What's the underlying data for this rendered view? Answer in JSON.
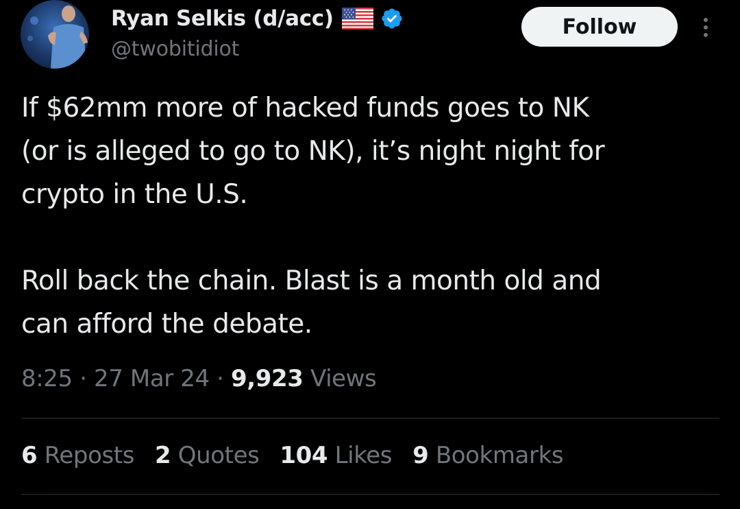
{
  "author": {
    "display_name": "Ryan Selkis (d/acc)",
    "handle": "@twobitidiot",
    "flag_icon": "us-flag-icon",
    "verified_icon": "verified-badge-icon",
    "verified_color": "#1d9bf0"
  },
  "actions": {
    "follow_label": "Follow",
    "more_icon": "more-vertical-icon"
  },
  "tweet": {
    "text": "If $62mm more of hacked funds goes to NK\n(or is alleged to go to NK), it’s night night for\ncrypto in the U.S.\n\nRoll back the chain. Blast is a month old and\ncan afford the debate.",
    "time": "8:25",
    "separator": "·",
    "date": "27 Mar 24",
    "views_count": "9,923",
    "views_label": "Views"
  },
  "stats": [
    {
      "count": "6",
      "label": "Reposts"
    },
    {
      "count": "2",
      "label": "Quotes"
    },
    {
      "count": "104",
      "label": "Likes"
    },
    {
      "count": "9",
      "label": "Bookmarks"
    }
  ],
  "colors": {
    "background": "#000000",
    "primary_text": "#e7e9ea",
    "secondary_text": "#71767b",
    "divider": "#2f3336",
    "follow_bg": "#eff3f4"
  }
}
